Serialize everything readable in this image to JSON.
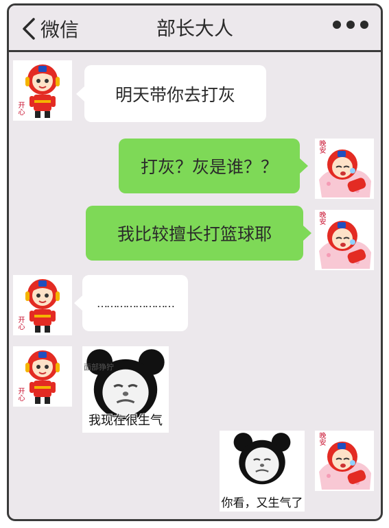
{
  "header": {
    "back_label": "微信",
    "title": "部长大人",
    "more_icon": "more-dots-icon"
  },
  "messages": [
    {
      "side": "left",
      "type": "text",
      "text": "明天带你去打灰"
    },
    {
      "side": "right",
      "type": "text",
      "text": "打灰？灰是谁？？"
    },
    {
      "side": "right",
      "type": "text",
      "text": "我比较擅长打篮球耶"
    },
    {
      "side": "left",
      "type": "text",
      "text": "……………………"
    },
    {
      "side": "left",
      "type": "sticker",
      "caption": "我现在很生气",
      "top_text": "面部狰狞"
    },
    {
      "side": "right",
      "type": "sticker",
      "caption": "你看，又生气了"
    }
  ],
  "avatars": {
    "left_badge": "开心",
    "right_badge": "晚安"
  },
  "colors": {
    "background": "#ece8ec",
    "incoming_bubble": "#ffffff",
    "outgoing_bubble": "#7ed957",
    "frame": "#3a3a3a"
  }
}
